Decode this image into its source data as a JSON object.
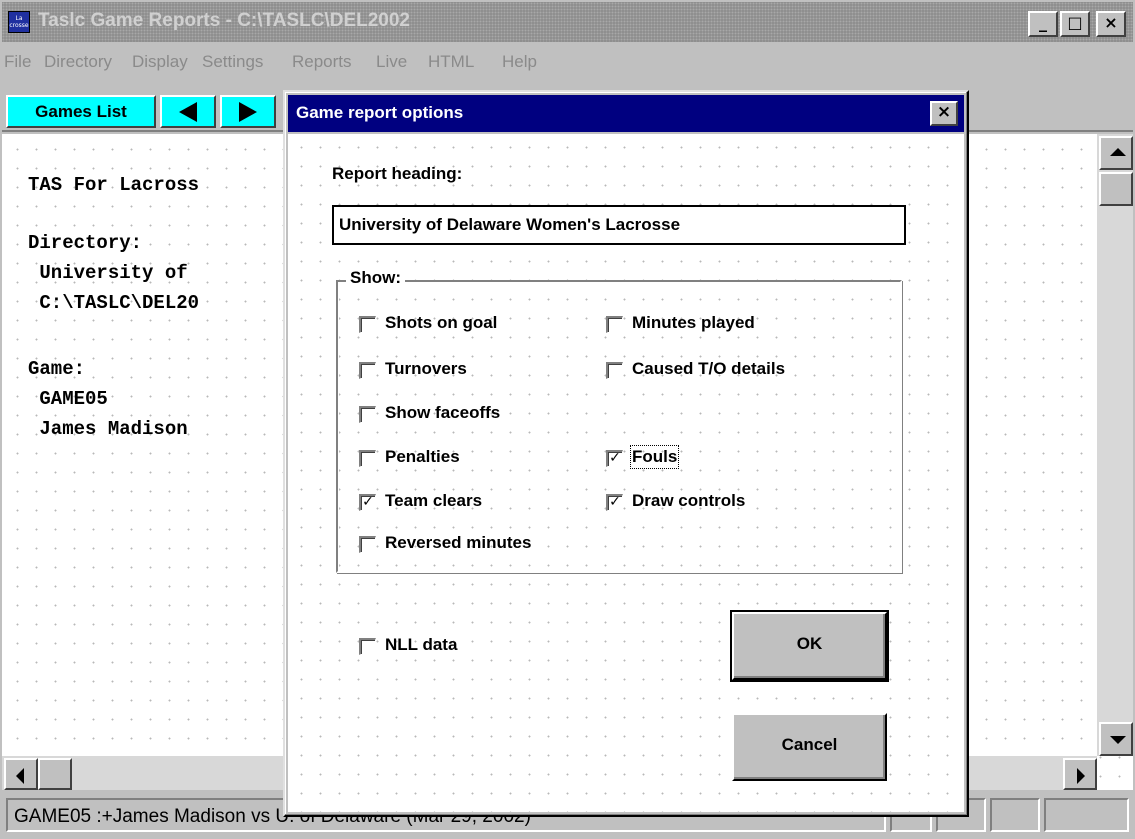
{
  "window": {
    "title": "Taslc Game Reports - C:\\TASLC\\DEL2002",
    "icon_text": "La crosse",
    "min_glyph": "_",
    "max_glyph": "□",
    "close_glyph": "×"
  },
  "menu": [
    "File",
    "Directory",
    "Display",
    "Settings",
    "Reports",
    "Live",
    "HTML",
    "Help"
  ],
  "toolbar": {
    "games_list_label": "Games List"
  },
  "document": {
    "lines": [
      "TAS For Lacross",
      "",
      "Directory:",
      " University of",
      " C:\\TASLC\\DEL20",
      "",
      "Game:",
      " GAME05",
      " James Madison"
    ]
  },
  "status": {
    "text": "GAME05  :+James Madison vs U. of Delaware (Mar 29, 2002)"
  },
  "dialog": {
    "title": "Game report options",
    "close_glyph": "×",
    "heading_label": "Report heading:",
    "heading_value": "University of Delaware Women's Lacrosse",
    "show_label": "Show:",
    "options": {
      "shots_on_goal": {
        "label": "Shots on goal",
        "checked": false
      },
      "minutes_played": {
        "label": "Minutes played",
        "checked": false
      },
      "turnovers": {
        "label": "Turnovers",
        "checked": false
      },
      "caused_to_details": {
        "label": "Caused T/O details",
        "checked": false
      },
      "show_faceoffs": {
        "label": "Show faceoffs",
        "checked": false
      },
      "penalties": {
        "label": "Penalties",
        "checked": false
      },
      "fouls": {
        "label": "Fouls",
        "checked": true
      },
      "team_clears": {
        "label": "Team clears",
        "checked": true
      },
      "draw_controls": {
        "label": "Draw controls",
        "checked": true
      },
      "reversed_minutes": {
        "label": "Reversed minutes",
        "checked": false
      }
    },
    "nll_data": {
      "label": "NLL data",
      "checked": false
    },
    "ok_label": "OK",
    "cancel_label": "Cancel",
    "check_glyph": "✓"
  }
}
